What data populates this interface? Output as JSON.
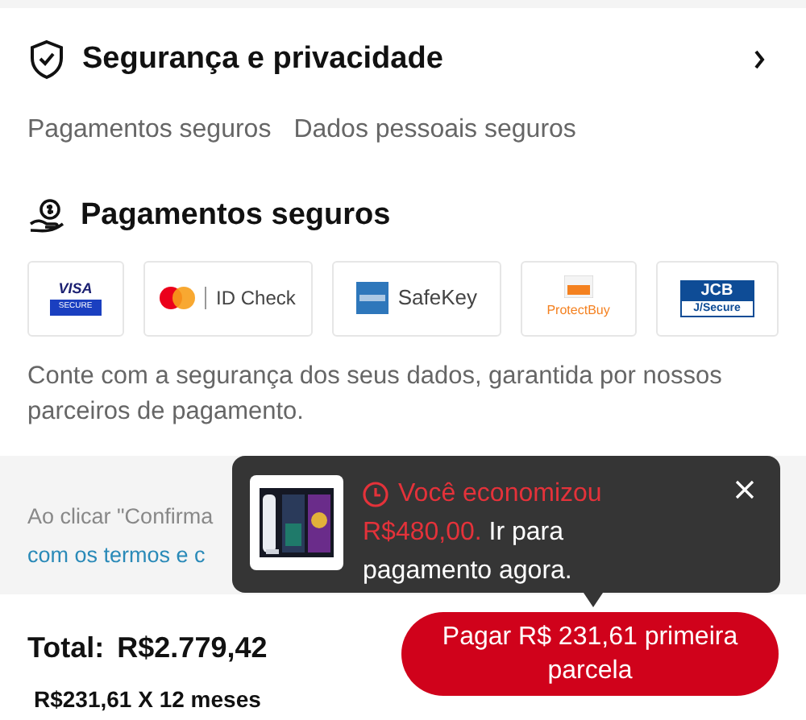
{
  "section": {
    "title": "Segurança e privacidade"
  },
  "tabs": [
    {
      "label": "Pagamentos seguros"
    },
    {
      "label": "Dados pessoais seguros"
    }
  ],
  "payments": {
    "title": "Pagamentos seguros",
    "logos": [
      {
        "kind": "visa",
        "texts": [
          "VISA",
          "SECURE"
        ]
      },
      {
        "kind": "mastercard",
        "texts": [
          "ID Check"
        ]
      },
      {
        "kind": "amex",
        "texts": [
          "SafeKey"
        ]
      },
      {
        "kind": "discover",
        "texts": [
          "ProtectBuy"
        ]
      },
      {
        "kind": "jcb",
        "texts": [
          "JCB",
          "J/Secure"
        ]
      }
    ],
    "description": "Conte com a segurança dos seus dados, garantida por nossos parceiros de pagamento."
  },
  "terms": {
    "line_1": "Ao clicar \"Confirma",
    "line_2": "com os termos e c"
  },
  "footer": {
    "total_label": "Total:",
    "total": "R$2.779,42",
    "installments": "R$231,61 X 12 meses",
    "pay_button": "Pagar R$ 231,61 primeira parcela"
  },
  "toast": {
    "headline": "Você economizou",
    "amount": "R$480,00.",
    "message": " Ir para pagamento agora."
  }
}
